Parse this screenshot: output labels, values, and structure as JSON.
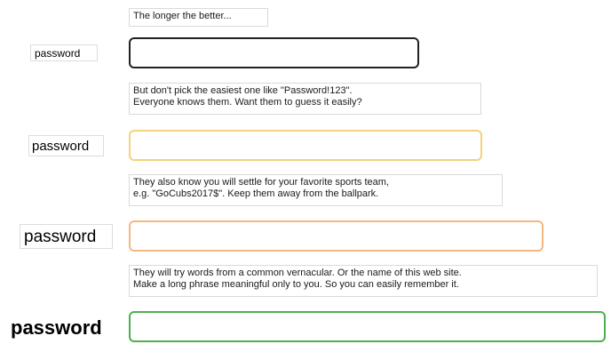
{
  "rows": [
    {
      "hint_lines": [
        "The longer the better..."
      ],
      "label": "password",
      "input_value": "",
      "border_color": "#222222"
    },
    {
      "hint_lines": [
        "But don't pick the easiest one like \"Password!123\".",
        "Everyone knows them. Want them to guess it easily?"
      ],
      "label": "password",
      "input_value": "",
      "border_color": "#f2d27a"
    },
    {
      "hint_lines": [
        "They also know you will settle for your favorite sports team,",
        "e.g. \"GoCubs2017$\". Keep them away from the ballpark."
      ],
      "label": "password",
      "input_value": "",
      "border_color": "#f4b77e"
    },
    {
      "hint_lines": [
        "They will try words from a common vernacular. Or the name of this web site.",
        "Make a long phrase meaningful only to you. So you can easily remember it."
      ],
      "label": "password",
      "input_value": "",
      "border_color": "#4caf50"
    }
  ]
}
